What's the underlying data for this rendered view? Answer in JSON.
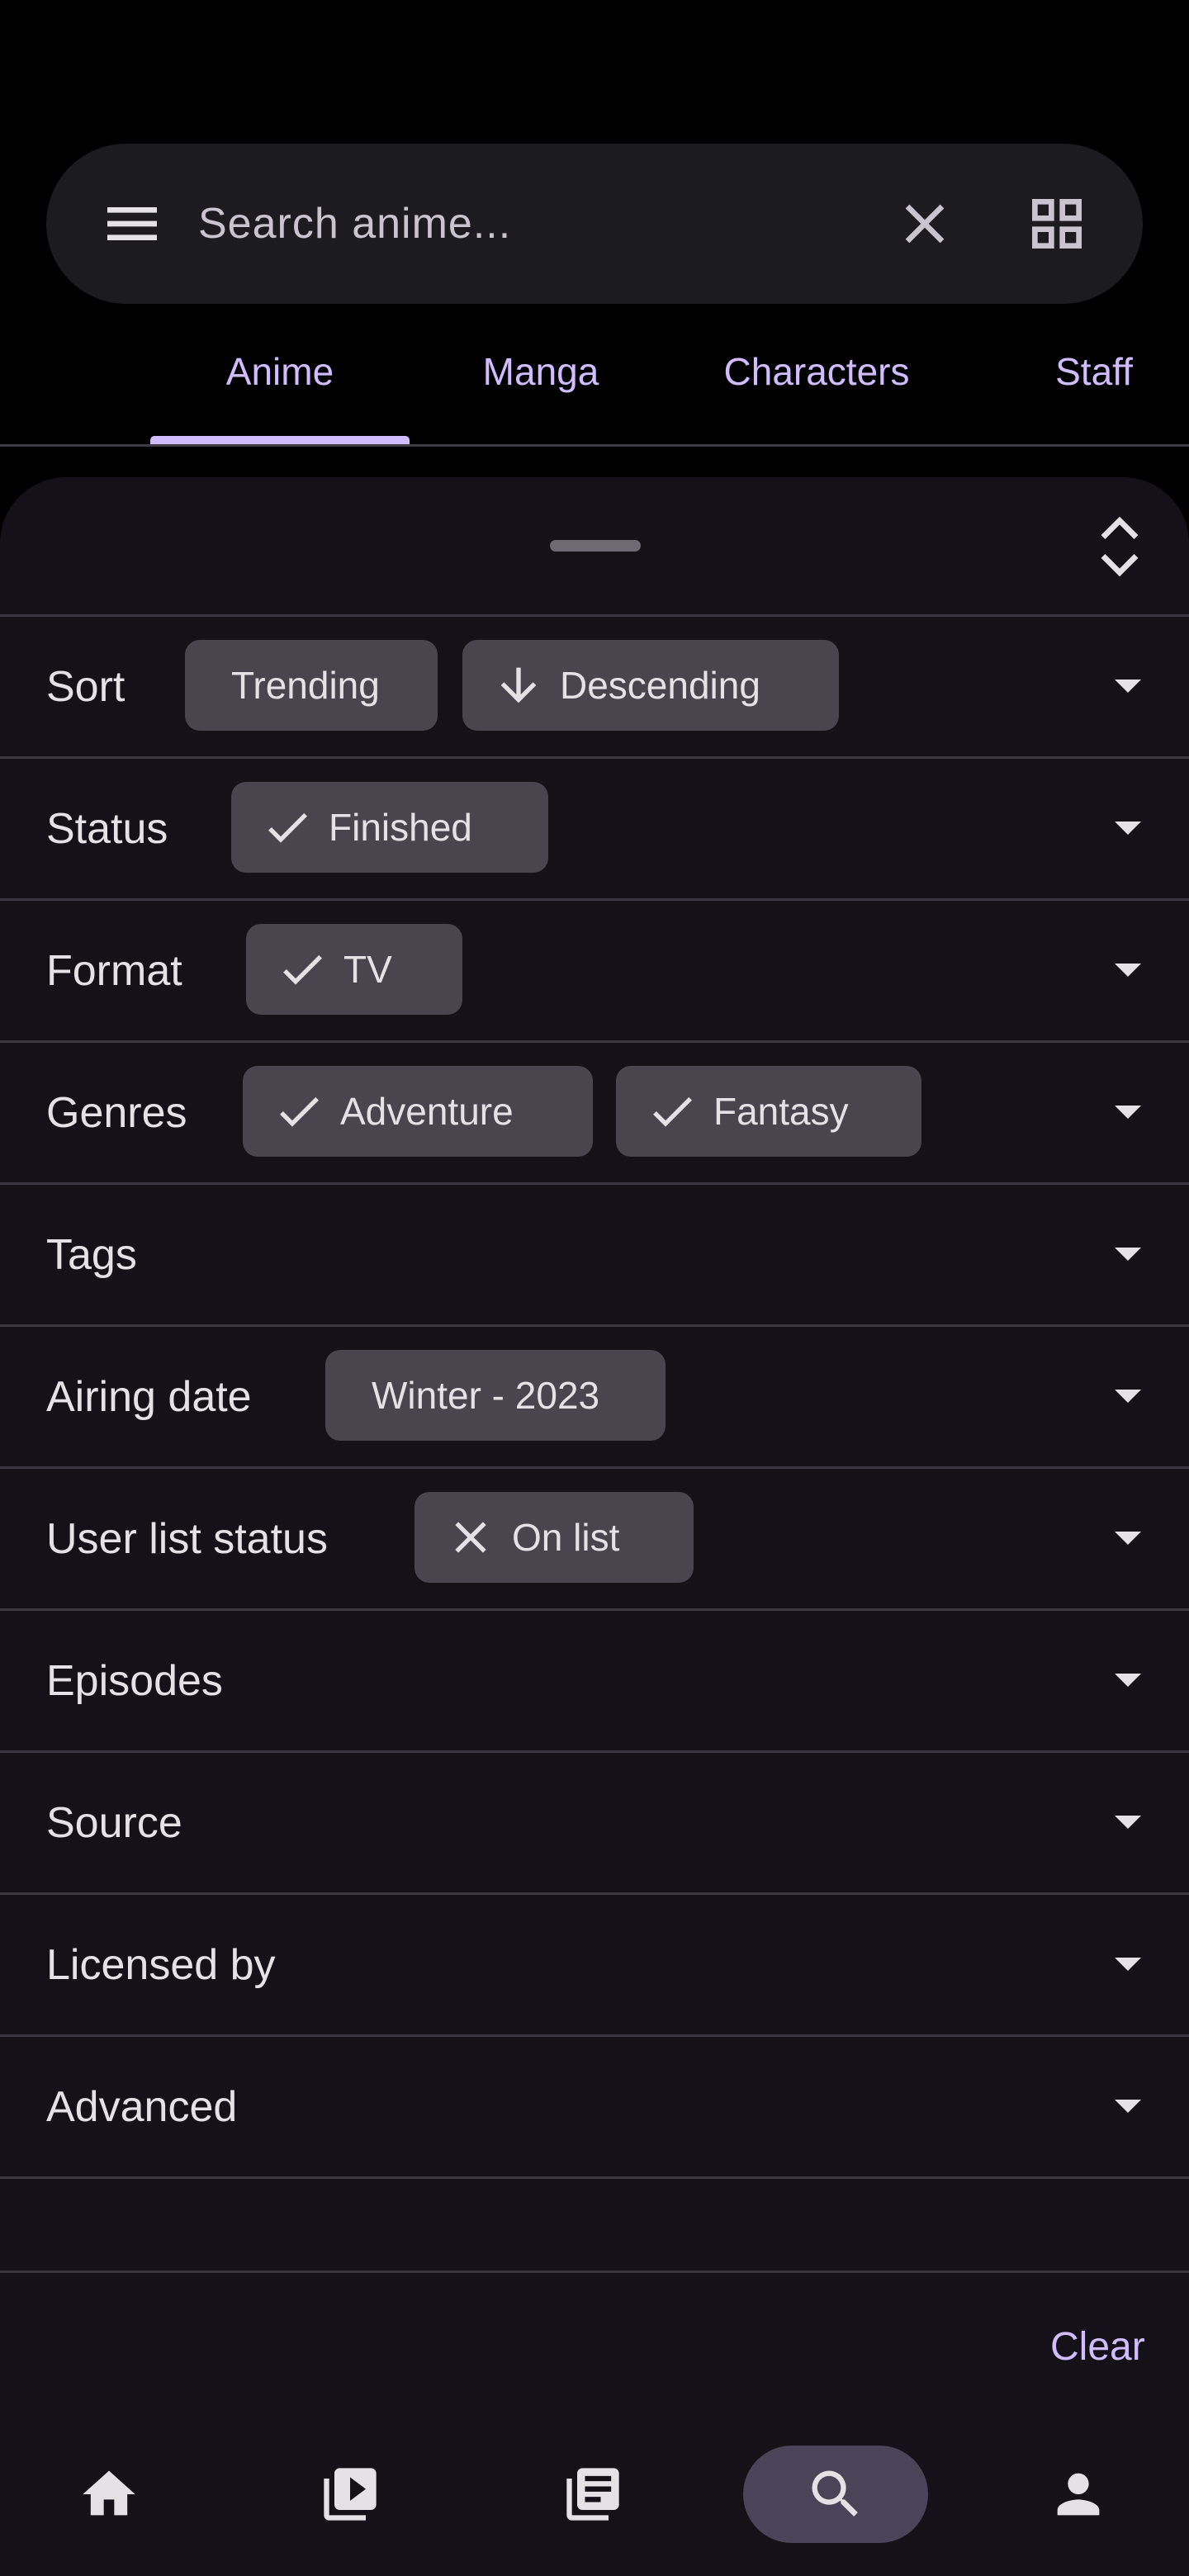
{
  "search": {
    "placeholder": "Search anime..."
  },
  "tabs": [
    {
      "label": "Anime",
      "active": true
    },
    {
      "label": "Manga"
    },
    {
      "label": "Characters"
    },
    {
      "label": "Staff"
    }
  ],
  "filters": [
    {
      "label": "Sort",
      "chips": [
        {
          "icon": "none",
          "label": "Trending"
        },
        {
          "icon": "arrow-down-icon",
          "label": "Descending"
        }
      ]
    },
    {
      "label": "Status",
      "chips": [
        {
          "icon": "check-icon",
          "label": "Finished"
        }
      ]
    },
    {
      "label": "Format",
      "chips": [
        {
          "icon": "check-icon",
          "label": "TV"
        }
      ]
    },
    {
      "label": "Genres",
      "chips": [
        {
          "icon": "check-icon",
          "label": "Adventure"
        },
        {
          "icon": "check-icon",
          "label": "Fantasy"
        }
      ]
    },
    {
      "label": "Tags",
      "chips": []
    },
    {
      "label": "Airing date",
      "chips": [
        {
          "icon": "none",
          "label": "Winter - 2023"
        }
      ]
    },
    {
      "label": "User list status",
      "chips": [
        {
          "icon": "x-icon",
          "label": "On list"
        }
      ]
    },
    {
      "label": "Episodes",
      "chips": []
    },
    {
      "label": "Source",
      "chips": []
    },
    {
      "label": "Licensed by",
      "chips": []
    },
    {
      "label": "Advanced",
      "chips": []
    }
  ],
  "actions": {
    "clear_label": "Clear"
  },
  "bottom_nav": [
    {
      "icon": "home-icon"
    },
    {
      "icon": "video-library-icon"
    },
    {
      "icon": "book-library-icon"
    },
    {
      "icon": "search-icon",
      "active": true
    },
    {
      "icon": "account-icon"
    }
  ],
  "colors": {
    "accent": "#D0BCFF",
    "chip_bg": "#49454F",
    "sheet_bg": "#141218",
    "search_bg": "#1C1B20",
    "active_nav_bg": "#4A4458"
  }
}
